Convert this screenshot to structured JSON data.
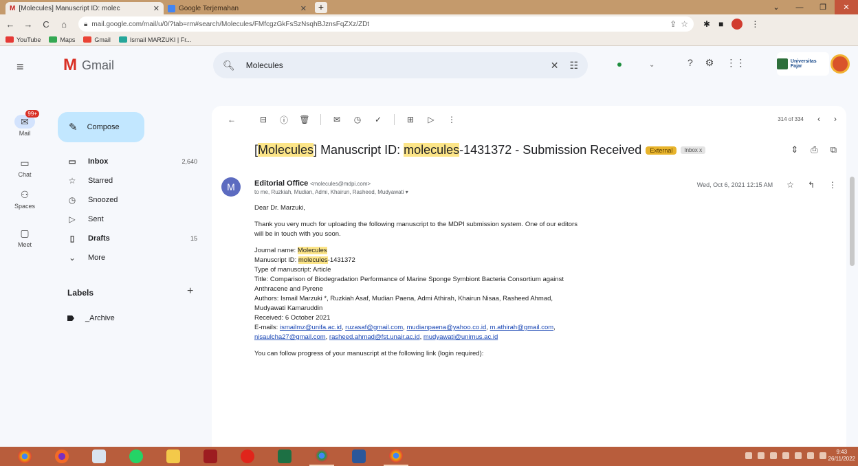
{
  "browser": {
    "tabs": [
      {
        "title": "[Molecules] Manuscript ID: molec",
        "active": true
      },
      {
        "title": "Google Terjemahan",
        "active": false
      }
    ],
    "url": "mail.google.com/mail/u/0/?tab=rm#search/Molecules/FMfcgzGkFsSzNsqhBJznsFqZXz/ZDt",
    "bookmarks": [
      "YouTube",
      "Maps",
      "Gmail",
      "Ismail MARZUKI | Fr..."
    ]
  },
  "rail": {
    "items": [
      {
        "label": "Mail",
        "icon": "mail-icon",
        "badge": "99+",
        "active": true
      },
      {
        "label": "Chat",
        "icon": "chat-icon"
      },
      {
        "label": "Spaces",
        "icon": "spaces-icon"
      },
      {
        "label": "Meet",
        "icon": "video-icon"
      }
    ]
  },
  "nav": {
    "logo": "Gmail",
    "compose": "Compose",
    "items": [
      {
        "label": "Inbox",
        "count": "2,640",
        "bold": true,
        "icon": "inbox-icon"
      },
      {
        "label": "Starred",
        "count": "",
        "bold": false,
        "icon": "star-icon"
      },
      {
        "label": "Snoozed",
        "count": "",
        "bold": false,
        "icon": "clock-icon"
      },
      {
        "label": "Sent",
        "count": "",
        "bold": false,
        "icon": "send-icon"
      },
      {
        "label": "Drafts",
        "count": "15",
        "bold": true,
        "icon": "draft-icon"
      },
      {
        "label": "More",
        "count": "",
        "bold": false,
        "icon": "chevron-down-icon"
      }
    ],
    "labels_title": "Labels",
    "labels": [
      {
        "label": "_Archive"
      }
    ]
  },
  "search": {
    "value": "Molecules"
  },
  "org_badge": "Universitas Fajar",
  "message": {
    "pager": "314 of 334",
    "subject_parts": [
      {
        "text": "[",
        "hl": false
      },
      {
        "text": "Molecules",
        "hl": true
      },
      {
        "text": "] Manuscript ID: ",
        "hl": false
      },
      {
        "text": "molecules",
        "hl": true
      },
      {
        "text": "-1431372 - Submission Received",
        "hl": false
      }
    ],
    "chip_external": "External",
    "chip_inbox": "Inbox x",
    "sender_initial": "M",
    "sender_name": "Editorial Office",
    "sender_email": "<molecules@mdpi.com>",
    "to": "to me, Ruzkiah, Mudian, Admi, Khairun, Rasheed, Mudyawati",
    "date": "Wed, Oct 6, 2021 12:15 AM",
    "greeting": "Dear Dr. Marzuki,",
    "para1": "Thank you very much for uploading the following manuscript to the MDPI submission system. One of our editors will be in touch with you soon.",
    "journal_label": "Journal name: ",
    "journal_name": "Molecules",
    "msid_label": "Manuscript ID: ",
    "msid_hl": "molecules",
    "msid_rest": "-1431372",
    "type": "Type of manuscript: Article",
    "title": "Title: Comparison of Biodegradation Performance of Marine Sponge Symbiont Bacteria Consortium against Anthracene and Pyrene",
    "authors": "Authors: Ismail Marzuki *, Ruzkiah Asaf, Mudian Paena, Admi Athirah, Khairun Nisaa, Rasheed Ahmad, Mudyawati Kamaruddin",
    "received": "Received: 6 October 2021",
    "emails_label": "E-mails: ",
    "emails": [
      "ismailmz@unifa.ac.id",
      "ruzasaf@gmail.com",
      "mudianpaena@yahoo.co.id",
      "m.athirah@gmail.com",
      "nisaulcha27@gmail.com",
      "rasheed.ahmad@fst.unair.ac.id",
      "mudyawati@unimus.ac.id"
    ],
    "closing": "You can follow progress of your manuscript at the following link (login required):"
  },
  "clock": {
    "time": "9:43",
    "date": "26/11/2022"
  }
}
